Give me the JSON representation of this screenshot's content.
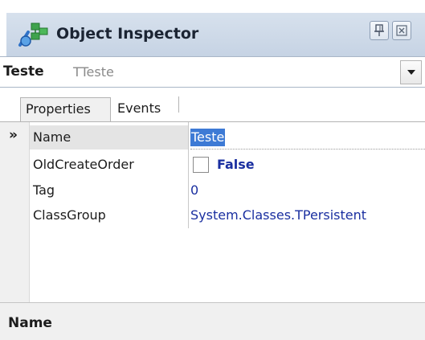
{
  "window": {
    "title": "Object Inspector",
    "icons": {
      "app": "object-inspector-icon",
      "pin": "pin-icon",
      "close": "close-icon",
      "dropdown": "chevron-down-icon",
      "selected_row": "double-chevron-right-icon"
    }
  },
  "selector": {
    "object_name": "Teste",
    "object_type": "TTeste"
  },
  "tabs": [
    {
      "label": "Properties",
      "active": true
    },
    {
      "label": "Events",
      "active": false
    }
  ],
  "properties": [
    {
      "name": "Name",
      "value": "Teste",
      "selected": true
    },
    {
      "name": "OldCreateOrder",
      "value": "False",
      "checkbox": true,
      "checked": false
    },
    {
      "name": "Tag",
      "value": "0"
    },
    {
      "name": "ClassGroup",
      "value": "System.Classes.TPersistent"
    }
  ],
  "description": {
    "title": "Name"
  },
  "colors": {
    "title_bar": "#c6d3e4",
    "value_text": "#1a2fa0",
    "selection": "#3d7ad5",
    "panel_bg": "#f0f0f0"
  }
}
